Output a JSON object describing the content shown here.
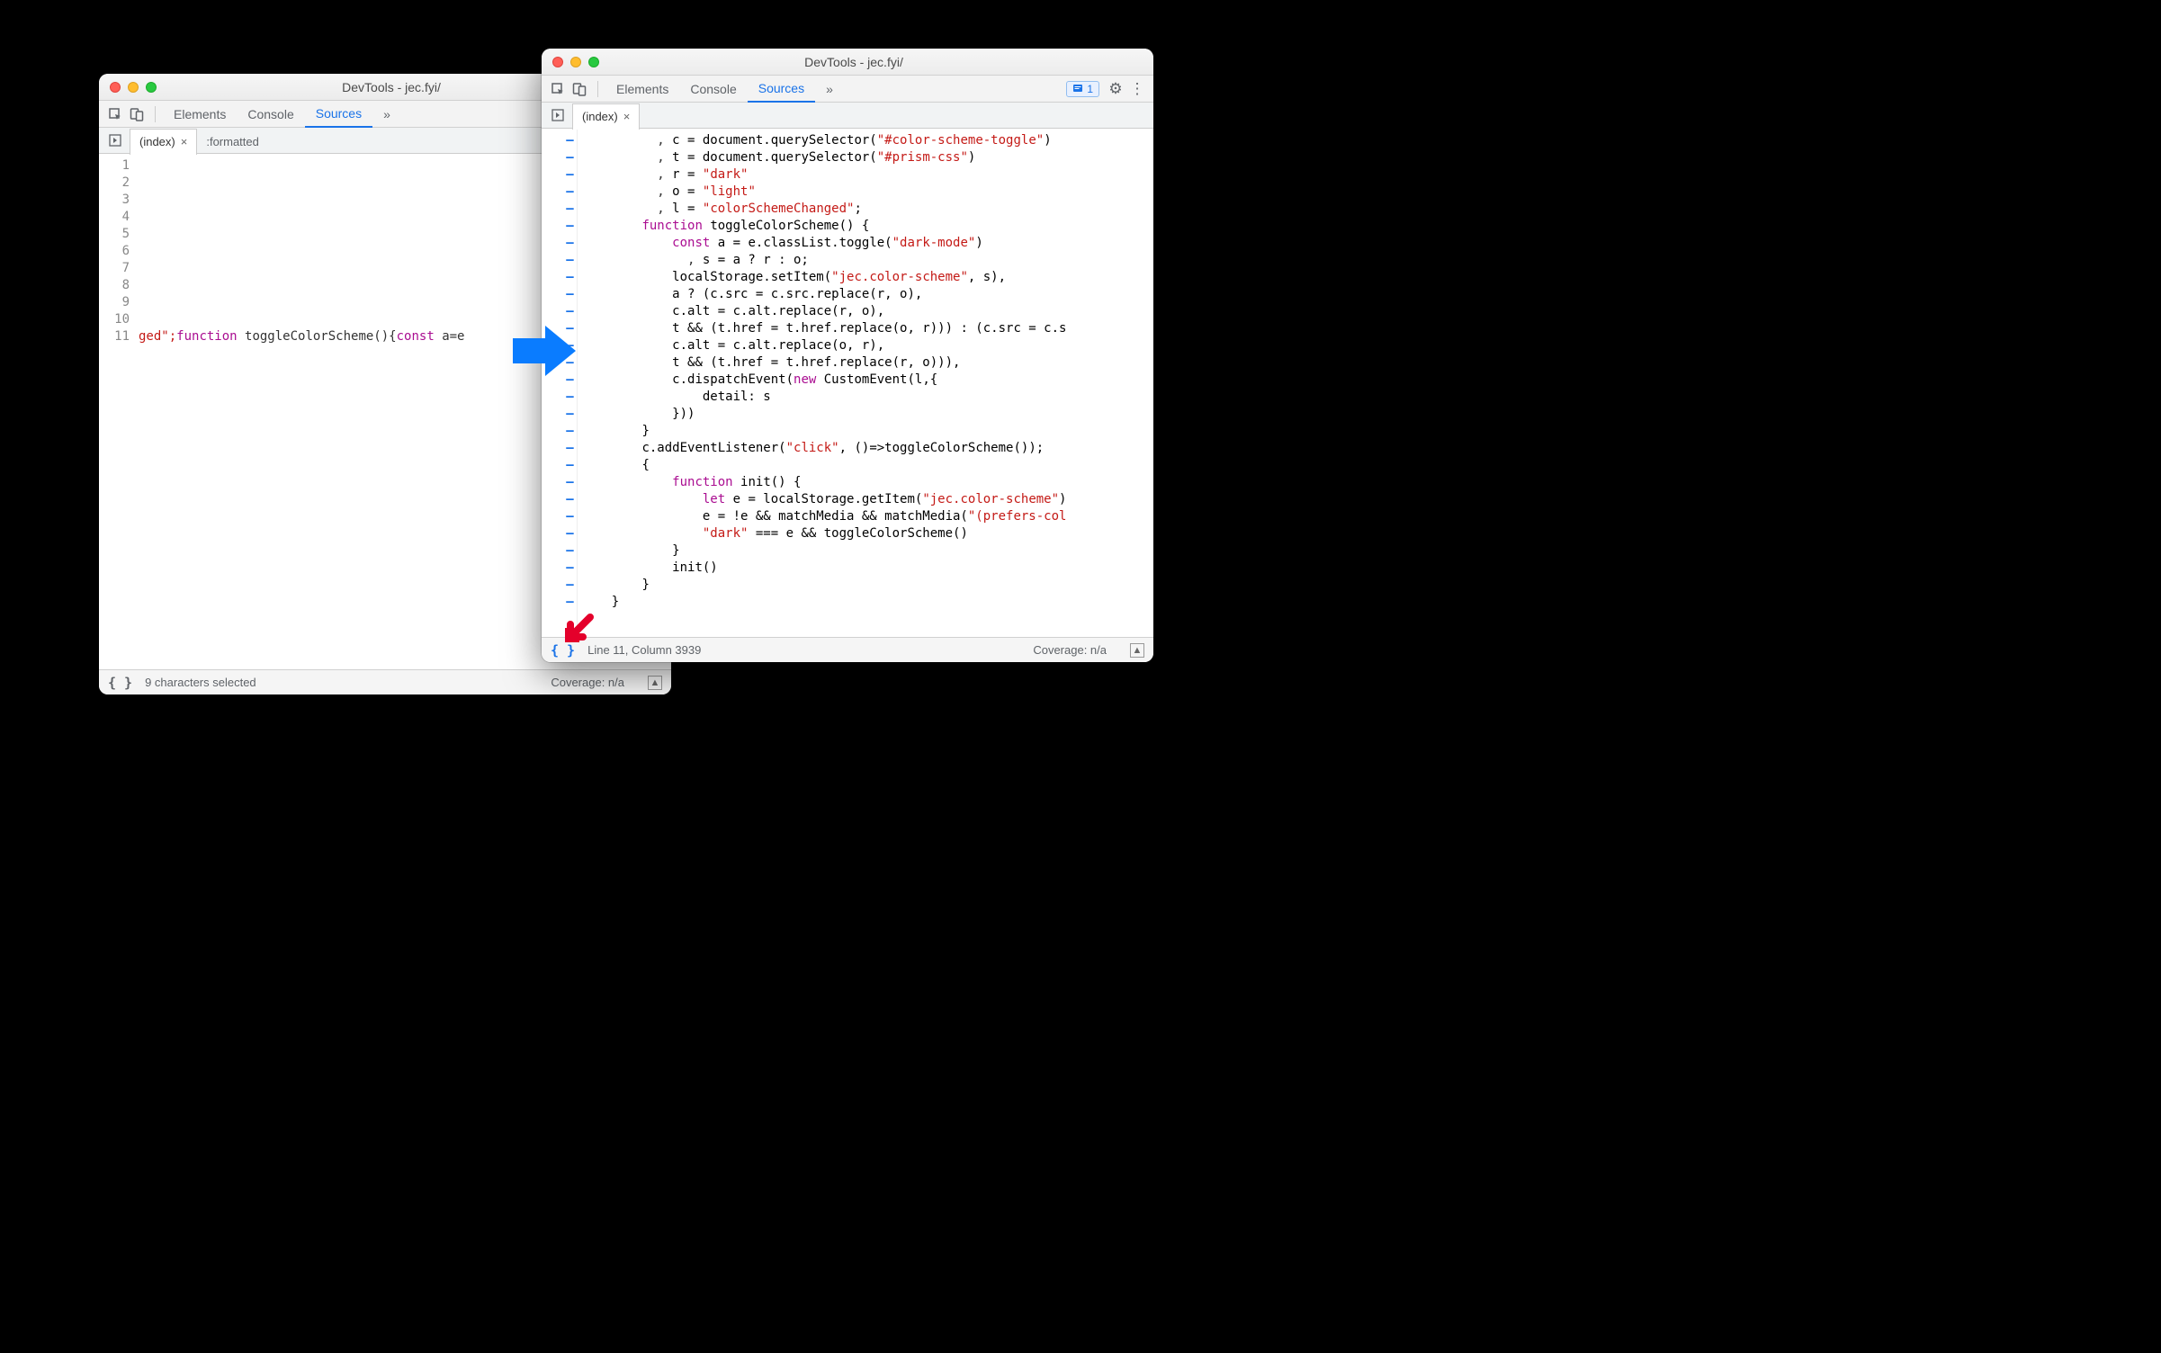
{
  "left": {
    "title": "DevTools - jec.fyi/",
    "tabs": [
      "Elements",
      "Console",
      "Sources"
    ],
    "active_tab": "Sources",
    "more": "»",
    "open_files": {
      "primary": "(index)",
      "secondary": ":formatted"
    },
    "line_numbers": [
      "1",
      "2",
      "3",
      "4",
      "5",
      "6",
      "7",
      "8",
      "9",
      "10",
      "11"
    ],
    "code_line": {
      "pre": "ged\";",
      "kw1": "function",
      "fn": " toggleColorScheme(){",
      "kw2": "const",
      "rest": " a=e"
    },
    "status_left": "9 characters selected",
    "status_right": "Coverage: n/a",
    "braces": "{ }"
  },
  "right": {
    "title": "DevTools - jec.fyi/",
    "tabs": [
      "Elements",
      "Console",
      "Sources"
    ],
    "active_tab": "Sources",
    "more": "»",
    "issues_count": "1",
    "open_file": "(index)",
    "code": [
      {
        "i": "          , ",
        "t": [
          [
            "v",
            "c"
          ],
          [
            "p",
            " = document.querySelector("
          ],
          [
            "s",
            "\"#color-scheme-toggle\""
          ],
          [
            "p",
            ")"
          ]
        ]
      },
      {
        "i": "          , ",
        "t": [
          [
            "v",
            "t"
          ],
          [
            "p",
            " = document.querySelector("
          ],
          [
            "s",
            "\"#prism-css\""
          ],
          [
            "p",
            ")"
          ]
        ]
      },
      {
        "i": "          , ",
        "t": [
          [
            "v",
            "r"
          ],
          [
            "p",
            " = "
          ],
          [
            "s",
            "\"dark\""
          ]
        ]
      },
      {
        "i": "          , ",
        "t": [
          [
            "v",
            "o"
          ],
          [
            "p",
            " = "
          ],
          [
            "s",
            "\"light\""
          ]
        ]
      },
      {
        "i": "          , ",
        "t": [
          [
            "v",
            "l"
          ],
          [
            "p",
            " = "
          ],
          [
            "s",
            "\"colorSchemeChanged\""
          ],
          [
            "p",
            ";"
          ]
        ]
      },
      {
        "i": "        ",
        "t": [
          [
            "k",
            "function"
          ],
          [
            "p",
            " "
          ],
          [
            "f",
            "toggleColorScheme"
          ],
          [
            "p",
            "() {"
          ]
        ]
      },
      {
        "i": "            ",
        "t": [
          [
            "k",
            "const"
          ],
          [
            "p",
            " a = e.classList.toggle("
          ],
          [
            "s",
            "\"dark-mode\""
          ],
          [
            "p",
            ")"
          ]
        ]
      },
      {
        "i": "              , ",
        "t": [
          [
            "p",
            "s = a ? r : o;"
          ]
        ]
      },
      {
        "i": "            ",
        "t": [
          [
            "p",
            "localStorage.setItem("
          ],
          [
            "s",
            "\"jec.color-scheme\""
          ],
          [
            "p",
            ", s),"
          ]
        ]
      },
      {
        "i": "            ",
        "t": [
          [
            "p",
            "a ? (c.src = c.src.replace(r, o),"
          ]
        ]
      },
      {
        "i": "            ",
        "t": [
          [
            "p",
            "c.alt = c.alt.replace(r, o),"
          ]
        ]
      },
      {
        "i": "            ",
        "t": [
          [
            "p",
            "t && (t.href = t.href.replace(o, r))) : (c.src = c.s"
          ]
        ]
      },
      {
        "i": "            ",
        "t": [
          [
            "p",
            "c.alt = c.alt.replace(o, r),"
          ]
        ]
      },
      {
        "i": "            ",
        "t": [
          [
            "p",
            "t && (t.href = t.href.replace(r, o))),"
          ]
        ]
      },
      {
        "i": "            ",
        "t": [
          [
            "p",
            "c.dispatchEvent("
          ],
          [
            "k",
            "new"
          ],
          [
            "p",
            " CustomEvent(l,{"
          ]
        ]
      },
      {
        "i": "                ",
        "t": [
          [
            "p",
            "detail: s"
          ]
        ]
      },
      {
        "i": "            ",
        "t": [
          [
            "p",
            "}))"
          ]
        ]
      },
      {
        "i": "        ",
        "t": [
          [
            "p",
            "}"
          ]
        ]
      },
      {
        "i": "        ",
        "t": [
          [
            "p",
            "c.addEventListener("
          ],
          [
            "s",
            "\"click\""
          ],
          [
            "p",
            ", ()=>toggleColorScheme());"
          ]
        ]
      },
      {
        "i": "        ",
        "t": [
          [
            "p",
            "{"
          ]
        ]
      },
      {
        "i": "            ",
        "t": [
          [
            "k",
            "function"
          ],
          [
            "p",
            " "
          ],
          [
            "f",
            "init"
          ],
          [
            "p",
            "() {"
          ]
        ]
      },
      {
        "i": "                ",
        "t": [
          [
            "k",
            "let"
          ],
          [
            "p",
            " e = localStorage.getItem("
          ],
          [
            "s",
            "\"jec.color-scheme\""
          ],
          [
            "p",
            ")"
          ]
        ]
      },
      {
        "i": "                ",
        "t": [
          [
            "p",
            "e = !e && matchMedia && matchMedia("
          ],
          [
            "s",
            "\"(prefers-col"
          ]
        ]
      },
      {
        "i": "                ",
        "t": [
          [
            "s",
            "\"dark\""
          ],
          [
            "p",
            " === e && toggleColorScheme()"
          ]
        ]
      },
      {
        "i": "            ",
        "t": [
          [
            "p",
            "}"
          ]
        ]
      },
      {
        "i": "            ",
        "t": [
          [
            "p",
            "init()"
          ]
        ]
      },
      {
        "i": "        ",
        "t": [
          [
            "p",
            "}"
          ]
        ]
      },
      {
        "i": "    ",
        "t": [
          [
            "p",
            "}"
          ]
        ]
      }
    ],
    "status_left": "Line 11, Column 3939",
    "status_right": "Coverage: n/a",
    "braces": "{ }"
  }
}
